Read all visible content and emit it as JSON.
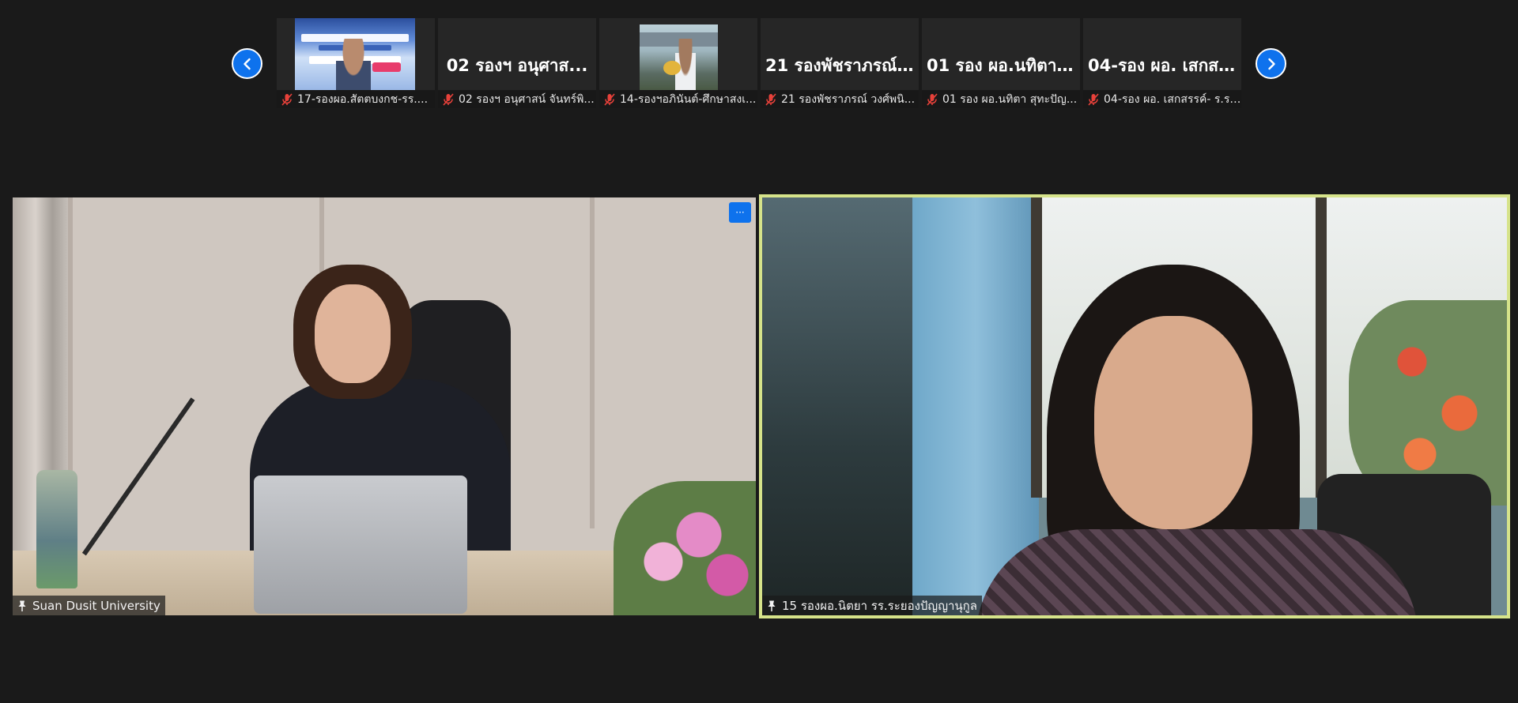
{
  "colors": {
    "background": "#1a1a1a",
    "accent": "#0e72ed",
    "active_speaker_border": "#d6e38a",
    "muted_icon": "#e8413a"
  },
  "navigation": {
    "prev_icon": "chevron-left-icon",
    "next_icon": "chevron-right-icon"
  },
  "thumbnails": [
    {
      "display": "video",
      "label": "17-รองผอ.สัตตบงกช-รร....",
      "muted": true
    },
    {
      "display": "name",
      "big_name": "02 รองฯ อนุศาส...",
      "label": "02 รองฯ อนุศาสน์ จันทร์พิ...",
      "muted": true
    },
    {
      "display": "video",
      "label": "14-รองฯอภินันต์-ศึกษาสงเ...",
      "muted": true
    },
    {
      "display": "name",
      "big_name": "21 รองพัชราภรณ์...",
      "label": "21 รองพัชราภรณ์ วงศ์พนิ...",
      "muted": true
    },
    {
      "display": "name",
      "big_name": "01 รอง ผอ.นทิตา...",
      "label": "01 รอง ผอ.นทิตา สุทะปัญ...",
      "muted": true
    },
    {
      "display": "name",
      "big_name": "04-รอง ผอ. เสกส...",
      "label": "04-รอง ผอ. เสกสรรค์- ร.ร....",
      "muted": true
    }
  ],
  "main_tiles": [
    {
      "name": "Suan Dusit University",
      "pinned": true,
      "more_label": "···"
    },
    {
      "name": "15 รองผอ.นิตยา  รร.ระยองปัญญานุกูล",
      "pinned": true,
      "active_speaker": true
    }
  ]
}
